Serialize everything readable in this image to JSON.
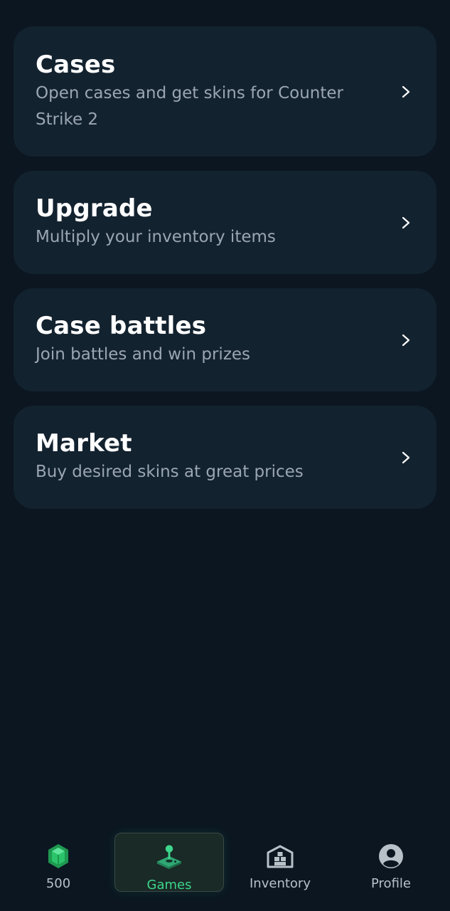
{
  "menu": {
    "items": [
      {
        "title": "Cases",
        "description": "Open cases and get skins for Counter Strike 2"
      },
      {
        "title": "Upgrade",
        "description": "Multiply your inventory items"
      },
      {
        "title": "Case battles",
        "description": "Join battles and win prizes"
      },
      {
        "title": "Market",
        "description": "Buy desired skins at great prices"
      }
    ]
  },
  "nav": {
    "balance": {
      "label": "500",
      "icon": "green-gem-icon"
    },
    "games": {
      "label": "Games",
      "icon": "joystick-icon",
      "active": true
    },
    "inventory": {
      "label": "Inventory",
      "icon": "warehouse-icon"
    },
    "profile": {
      "label": "Profile",
      "icon": "user-circle-icon"
    }
  },
  "colors": {
    "background": "#0b1621",
    "card": "#13222f",
    "accent": "#3dd68c",
    "muted_text": "#9aa6b2"
  }
}
